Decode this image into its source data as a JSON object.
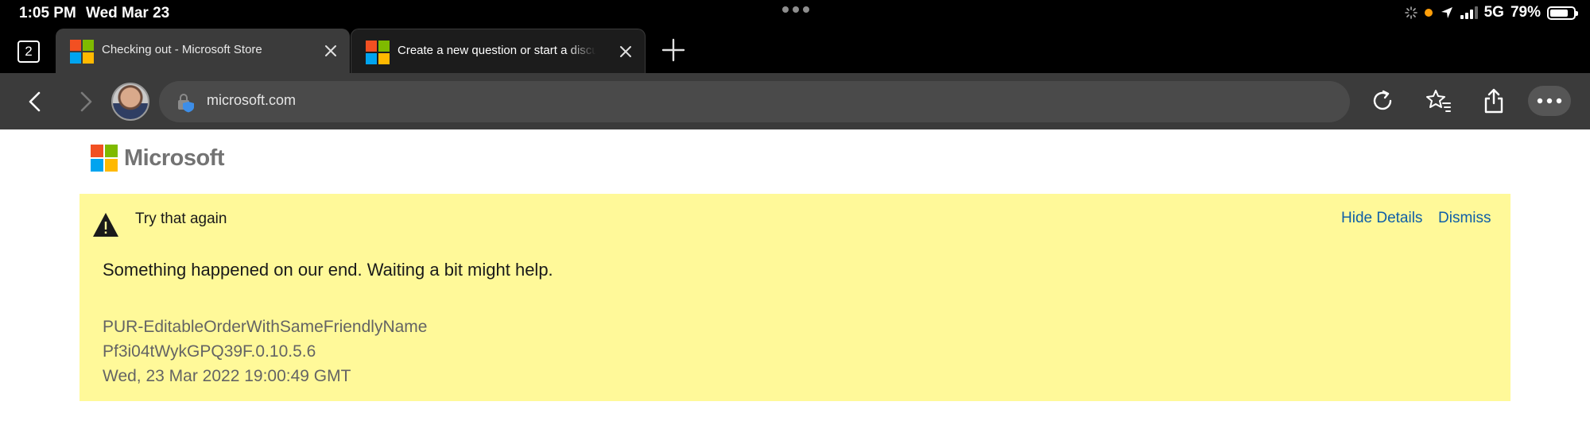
{
  "status_bar": {
    "time": "1:05 PM",
    "date": "Wed Mar 23",
    "network": "5G",
    "battery_percent_label": "79%",
    "battery_level": 0.79
  },
  "tab_bar": {
    "tab_count": "2",
    "tabs": [
      {
        "title": "Checking out - Microsoft Store",
        "active": true,
        "icon": "microsoft-logo-icon"
      },
      {
        "title": "Create a new question or start a discussion",
        "active": false,
        "icon": "microsoft-logo-icon"
      }
    ]
  },
  "toolbar": {
    "url": "microsoft.com"
  },
  "page": {
    "brand_name": "Microsoft",
    "alert": {
      "title": "Try that again",
      "hide_details_label": "Hide Details",
      "dismiss_label": "Dismiss",
      "message": "Something happened on our end. Waiting a bit might help.",
      "details": [
        "PUR-EditableOrderWithSameFriendlyName",
        "Pf3i04tWykGPQ39F.0.10.5.6",
        "Wed, 23 Mar 2022 19:00:49 GMT"
      ],
      "background_color": "#fff999",
      "link_color": "#0f5fa8"
    }
  }
}
